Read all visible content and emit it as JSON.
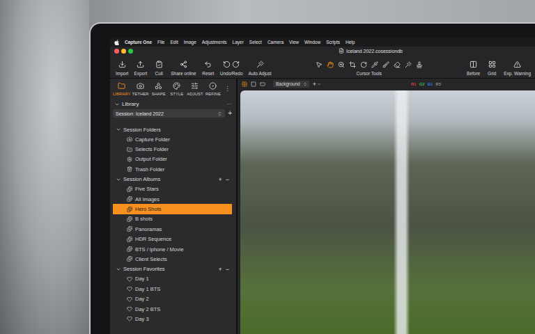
{
  "menu_bar": {
    "app": "Capture One",
    "items": [
      "File",
      "Edit",
      "Image",
      "Adjustments",
      "Layer",
      "Select",
      "Camera",
      "View",
      "Window",
      "Scripts",
      "Help"
    ]
  },
  "window": {
    "title": "Iceland 2022.cosessiondb"
  },
  "toolbar": {
    "left": [
      {
        "label": "Import",
        "kind": "import"
      },
      {
        "label": "Export",
        "kind": "export"
      },
      {
        "label": "Cull",
        "kind": "cull"
      },
      {
        "label": "Share online",
        "kind": "share"
      },
      {
        "label": "Reset",
        "kind": "reset"
      },
      {
        "label": "Undo/Redo",
        "kind": "undo-redo"
      },
      {
        "label": "Auto Adjust",
        "kind": "auto"
      }
    ],
    "cursor_tools": {
      "label": "Cursor Tools",
      "tools": [
        {
          "kind": "pointer",
          "selected": false
        },
        {
          "kind": "pan",
          "selected": true
        },
        {
          "kind": "zoom",
          "selected": false
        },
        {
          "kind": "crop",
          "selected": false
        },
        {
          "kind": "rotate",
          "selected": false
        },
        {
          "kind": "pick",
          "selected": false
        },
        {
          "kind": "brush",
          "selected": false
        },
        {
          "kind": "erase",
          "selected": false
        },
        {
          "kind": "wand",
          "selected": false
        },
        {
          "kind": "stamp",
          "selected": false
        }
      ]
    },
    "right": [
      {
        "label": "Before",
        "kind": "before"
      },
      {
        "label": "Grid",
        "kind": "grid"
      },
      {
        "label": "Exp. Warning",
        "kind": "warning"
      }
    ]
  },
  "tool_tabs": [
    {
      "label": "LIBRARY",
      "kind": "library",
      "selected": true
    },
    {
      "label": "TETHER",
      "kind": "tether",
      "selected": false
    },
    {
      "label": "SHAPE",
      "kind": "shape",
      "selected": false
    },
    {
      "label": "STYLE",
      "kind": "style",
      "selected": false
    },
    {
      "label": "ADJUST",
      "kind": "adjust",
      "selected": false
    },
    {
      "label": "REFINE",
      "kind": "refine",
      "selected": false
    }
  ],
  "tool_tabs_more": "⋮",
  "library": {
    "title": "Library",
    "more": "···",
    "session": "Session: Iceland 2022",
    "session_add": "+",
    "sections": [
      {
        "title": "Session Folders",
        "expanded": true,
        "actions": [],
        "items": [
          {
            "label": "Capture Folder",
            "kind": "capture",
            "selected": false
          },
          {
            "label": "Selects Folder",
            "kind": "selects",
            "selected": false
          },
          {
            "label": "Output Folder",
            "kind": "output",
            "selected": false
          },
          {
            "label": "Trash Folder",
            "kind": "trash",
            "selected": false
          }
        ]
      },
      {
        "title": "Session Albums",
        "expanded": true,
        "actions": [
          "+",
          "−"
        ],
        "items": [
          {
            "label": "Five Stars",
            "kind": "album",
            "selected": false
          },
          {
            "label": "All Images",
            "kind": "album",
            "selected": false
          },
          {
            "label": "Hero Shots",
            "kind": "album",
            "selected": true
          },
          {
            "label": "B shots",
            "kind": "album",
            "selected": false
          },
          {
            "label": "Panoramas",
            "kind": "album",
            "selected": false
          },
          {
            "label": "HDR Sequence",
            "kind": "album",
            "selected": false
          },
          {
            "label": "BTS / iphone / Movie",
            "kind": "album",
            "selected": false
          },
          {
            "label": "Client Selects",
            "kind": "album",
            "selected": false
          }
        ]
      },
      {
        "title": "Session Favorites",
        "expanded": true,
        "actions": [
          "+",
          "−"
        ],
        "items": [
          {
            "label": "Day 1",
            "kind": "favorite",
            "selected": false
          },
          {
            "label": "Day 1 BTS",
            "kind": "favorite",
            "selected": false
          },
          {
            "label": "Day 2",
            "kind": "favorite",
            "selected": false
          },
          {
            "label": "Day 2 BTS",
            "kind": "favorite",
            "selected": false
          },
          {
            "label": "Day 3",
            "kind": "favorite",
            "selected": false
          }
        ]
      }
    ]
  },
  "viewer": {
    "view_modes": [
      {
        "kind": "grid",
        "selected": true
      },
      {
        "kind": "single",
        "selected": false
      },
      {
        "kind": "wide",
        "selected": false
      }
    ],
    "background": "Background",
    "add": "+",
    "color_tags": [
      {
        "label": "R1",
        "color": "#d9413a"
      },
      {
        "label": "G2",
        "color": "#3fae4f"
      },
      {
        "label": "B1",
        "color": "#3a6fd9"
      },
      {
        "label": "R5",
        "color": "#8a8a8a"
      }
    ]
  }
}
